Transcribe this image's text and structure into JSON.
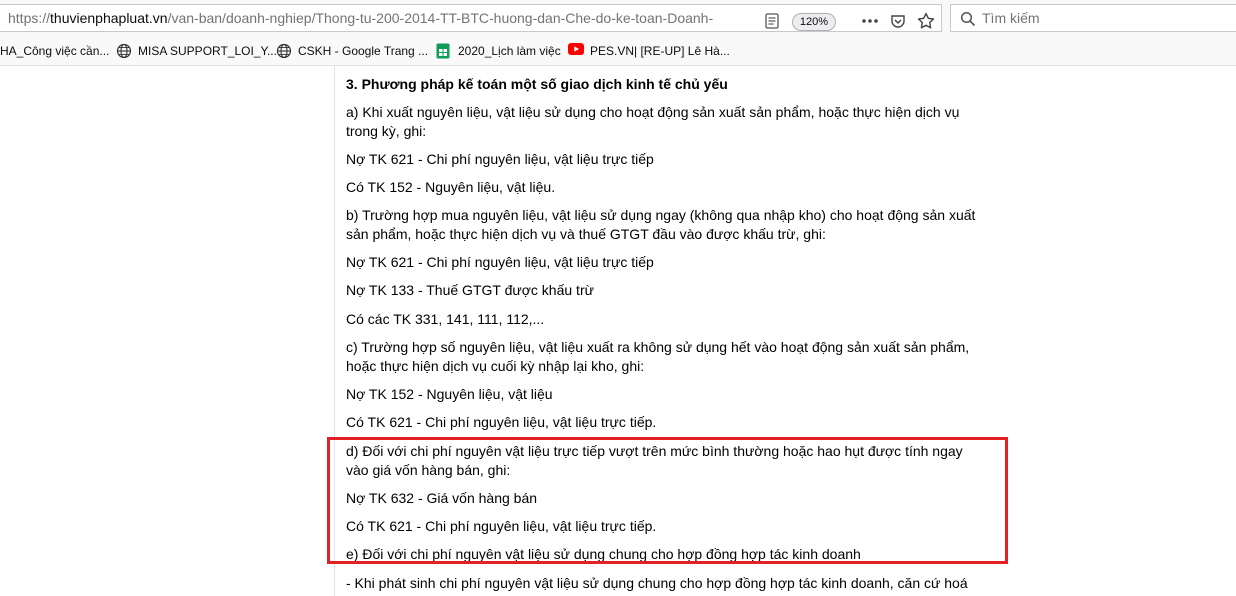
{
  "browser": {
    "url": "https://thuvienphapluat.vn/van-ban/doanh-nghiep/Thong-tu-200-2014-TT-BTC-huong-dan-Che-do-ke-toan-Doanh-",
    "url_prefix": "https://",
    "url_host": "thuvienphapluat.vn",
    "url_path": "/van-ban/doanh-nghiep/Thong-tu-200-2014-TT-BTC-huong-dan-Che-do-ke-toan-Doanh-",
    "zoom": "120%",
    "search_placeholder": "Tìm kiếm"
  },
  "bookmarks": [
    {
      "label": "HA_Công việc cần...",
      "icon": "page-icon"
    },
    {
      "label": "MISA SUPPORT_LOI_Y...",
      "icon": "globe-icon"
    },
    {
      "label": "CSKH - Google Trang ...",
      "icon": "globe-icon"
    },
    {
      "label": "2020_Lịch làm việc",
      "icon": "sheets-icon"
    },
    {
      "label": "PES.VN| [RE-UP] Lê Hà...",
      "icon": "youtube-icon"
    }
  ],
  "document": {
    "heading": "3. Phương pháp kế toán một số giao dịch kinh tế chủ yếu",
    "paragraphs": [
      "a) Khi xuất nguyên liệu, vật liệu sử dụng cho hoạt động sản xuất sản phẩm, hoặc thực hiện dịch vụ trong kỳ, ghi:",
      "Nợ TK 621 - Chi phí nguyên liệu, vật liệu trực tiếp",
      "Có TK 152 - Nguyên liệu, vật liệu.",
      "b) Trường hợp mua nguyên liệu, vật liệu sử dụng ngay (không qua nhập kho) cho hoạt động sản xuất sản phẩm, hoặc thực hiện dịch vụ và thuế GTGT đầu vào được khấu trừ, ghi:",
      "Nợ TK 621 - Chi phí nguyên liệu, vật liệu trực tiếp",
      "Nợ TK 133 - Thuế GTGT được khấu trừ",
      "Có các TK 331, 141, 111, 112,...",
      "c) Trường hợp số nguyên liệu, vật liệu xuất ra không sử dụng hết vào hoạt động sản xuất sản phẩm, hoặc thực hiện dịch vụ cuối kỳ nhập lại kho, ghi:",
      "Nợ TK 152 - Nguyên liệu, vật liệu",
      "Có TK 621 - Chi phí nguyên liệu, vật liệu trực tiếp.",
      "d) Đối với chi phí nguyên vật liệu trực tiếp vượt trên mức bình thường hoặc hao hụt được tính ngay vào giá vốn hàng bán, ghi:",
      "Nợ TK 632 - Giá vốn hàng bán",
      "Có TK 621 - Chi phí nguyên liệu, vật liệu trực tiếp.",
      "e) Đối với chi phí nguyên vật liệu sử dụng chung cho hợp đồng hợp tác kinh doanh",
      "- Khi phát sinh chi phí nguyên vật liệu sử dụng chung cho hợp đồng hợp tác kinh doanh, căn cứ hoá"
    ]
  },
  "colors": {
    "highlight_border": "#e32025"
  }
}
